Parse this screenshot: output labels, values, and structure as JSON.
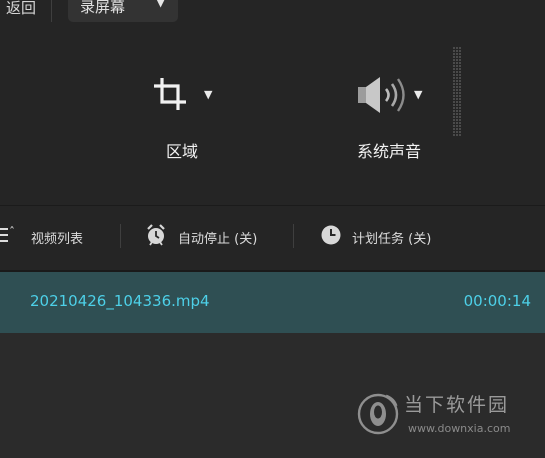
{
  "topbar": {
    "back_label": "返回",
    "mode_label": "录屏幕",
    "mode_caret": "▼"
  },
  "controls": {
    "region": {
      "label": "区域",
      "icon": "crop-icon",
      "caret": "▼"
    },
    "audio": {
      "label": "系统声音",
      "icon": "speaker-icon",
      "caret": "▼"
    }
  },
  "toolbar": {
    "video_list": {
      "label": "视频列表",
      "icon": "list-icon",
      "chevron": "ˆ"
    },
    "auto_stop": {
      "label": "自动停止 (关)",
      "icon": "alarm-clock-icon"
    },
    "schedule": {
      "label": "计划任务 (关)",
      "icon": "clock-icon"
    }
  },
  "recordings": [
    {
      "name": "20210426_104336.mp4",
      "duration": "00:00:14",
      "selected": true
    }
  ],
  "watermark": {
    "title": "当下软件园",
    "url": "www.downxia.com"
  },
  "colors": {
    "background": "#252525",
    "selected_row": "#2f4f53",
    "accent_text": "#4dd0e8"
  }
}
